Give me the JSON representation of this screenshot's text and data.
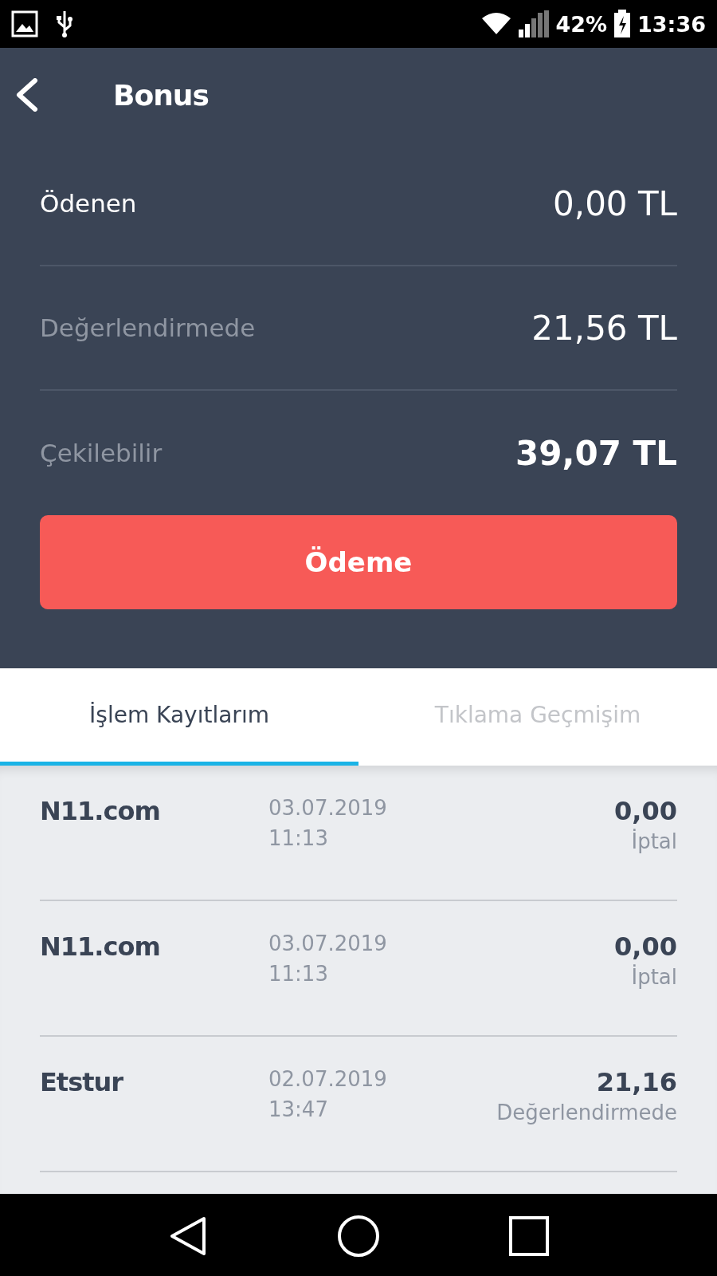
{
  "status_bar": {
    "battery": "42%",
    "time": "13:36"
  },
  "header": {
    "title": "Bonus"
  },
  "summary": [
    {
      "label": "Ödenen",
      "value": "0,00 TL",
      "muted": false,
      "emphasized": false
    },
    {
      "label": "Değerlendirmede",
      "value": "21,56 TL",
      "muted": true,
      "emphasized": false
    },
    {
      "label": "Çekilebilir",
      "value": "39,07 TL",
      "muted": true,
      "emphasized": true
    }
  ],
  "pay_button": "Ödeme",
  "tabs": [
    {
      "label": "İşlem Kayıtlarım",
      "selected": true
    },
    {
      "label": "Tıklama Geçmişim",
      "selected": false
    }
  ],
  "transactions": [
    {
      "merchant": "N11.com",
      "date": "03.07.2019",
      "time": "11:13",
      "amount": "0,00",
      "status": "İptal"
    },
    {
      "merchant": "N11.com",
      "date": "03.07.2019",
      "time": "11:13",
      "amount": "0,00",
      "status": "İptal"
    },
    {
      "merchant": "Etstur",
      "date": "02.07.2019",
      "time": "13:47",
      "amount": "21,16",
      "status": "Değerlendirmede"
    }
  ]
}
